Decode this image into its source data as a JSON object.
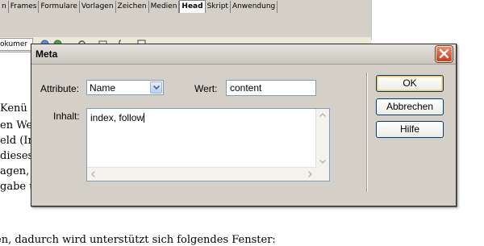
{
  "background": {
    "menu_tabs": [
      "n",
      "Frames",
      "Formulare",
      "Vorlagen",
      "Zeichen",
      "Medien",
      "Head",
      "Skript",
      "Anwendung"
    ],
    "active_tab": "Head",
    "doc_tab_label": "okumer",
    "text_lines": [
      "Kenü w",
      "en We",
      "eld (In",
      "dieses",
      "agen, e",
      "gabe u",
      "en, dadurch wird unterstützt sich folgendes Fenster:"
    ]
  },
  "dialog": {
    "title": "Meta",
    "attribute_label": "Attribute:",
    "attribute_value": "Name",
    "wert_label": "Wert:",
    "wert_value": "content",
    "inhalt_label": "Inhalt:",
    "inhalt_value": "index, follow",
    "buttons": {
      "ok": "OK",
      "cancel": "Abbrechen",
      "help": "Hilfe"
    }
  },
  "colors": {
    "dialog_bg": "#d4d0c8",
    "close_red": "#c63d1f",
    "input_border": "#7f9db9",
    "default_button_glow": "#f2c85e"
  }
}
